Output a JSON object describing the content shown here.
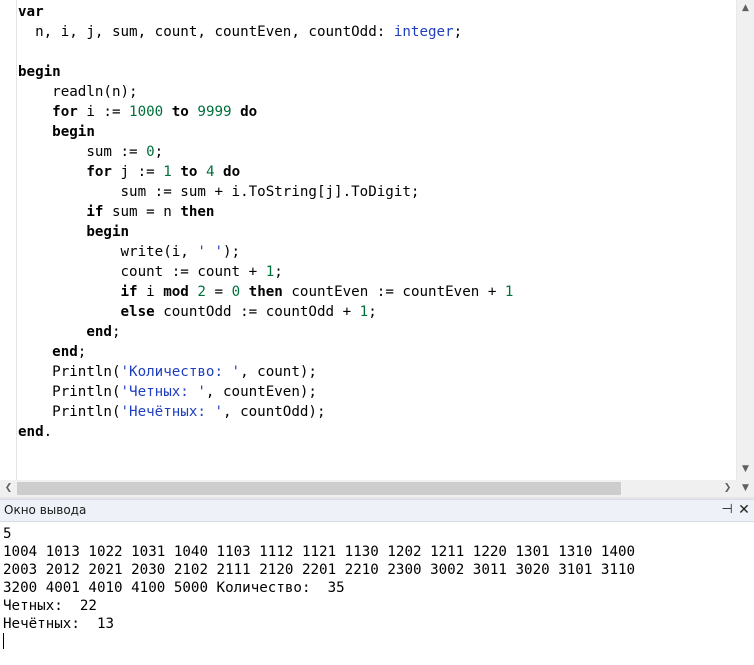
{
  "editor": {
    "lines": [
      [
        {
          "t": "var",
          "c": "kw"
        }
      ],
      [
        {
          "t": "  n, i, j, sum, count, countEven, countOdd: "
        },
        {
          "t": "integer",
          "c": "type"
        },
        {
          "t": ";"
        }
      ],
      [
        {
          "t": ""
        }
      ],
      [
        {
          "t": "begin",
          "c": "kw"
        }
      ],
      [
        {
          "t": "    readln(n);"
        }
      ],
      [
        {
          "t": "    "
        },
        {
          "t": "for",
          "c": "kw"
        },
        {
          "t": " i := "
        },
        {
          "t": "1000",
          "c": "num"
        },
        {
          "t": " "
        },
        {
          "t": "to",
          "c": "kw"
        },
        {
          "t": " "
        },
        {
          "t": "9999",
          "c": "num"
        },
        {
          "t": " "
        },
        {
          "t": "do",
          "c": "kw"
        }
      ],
      [
        {
          "t": "    "
        },
        {
          "t": "begin",
          "c": "kw"
        }
      ],
      [
        {
          "t": "        sum := "
        },
        {
          "t": "0",
          "c": "num"
        },
        {
          "t": ";"
        }
      ],
      [
        {
          "t": "        "
        },
        {
          "t": "for",
          "c": "kw"
        },
        {
          "t": " j := "
        },
        {
          "t": "1",
          "c": "num"
        },
        {
          "t": " "
        },
        {
          "t": "to",
          "c": "kw"
        },
        {
          "t": " "
        },
        {
          "t": "4",
          "c": "num"
        },
        {
          "t": " "
        },
        {
          "t": "do",
          "c": "kw"
        }
      ],
      [
        {
          "t": "            sum := sum + i.ToString[j].ToDigit;"
        }
      ],
      [
        {
          "t": "        "
        },
        {
          "t": "if",
          "c": "kw"
        },
        {
          "t": " sum = n "
        },
        {
          "t": "then",
          "c": "kw"
        }
      ],
      [
        {
          "t": "        "
        },
        {
          "t": "begin",
          "c": "kw"
        }
      ],
      [
        {
          "t": "            write(i, "
        },
        {
          "t": "' '",
          "c": "str"
        },
        {
          "t": ");"
        }
      ],
      [
        {
          "t": "            count := count + "
        },
        {
          "t": "1",
          "c": "num"
        },
        {
          "t": ";"
        }
      ],
      [
        {
          "t": "            "
        },
        {
          "t": "if",
          "c": "kw"
        },
        {
          "t": " i "
        },
        {
          "t": "mod",
          "c": "kw"
        },
        {
          "t": " "
        },
        {
          "t": "2",
          "c": "num"
        },
        {
          "t": " = "
        },
        {
          "t": "0",
          "c": "num"
        },
        {
          "t": " "
        },
        {
          "t": "then",
          "c": "kw"
        },
        {
          "t": " countEven := countEven + "
        },
        {
          "t": "1",
          "c": "num"
        }
      ],
      [
        {
          "t": "            "
        },
        {
          "t": "else",
          "c": "kw"
        },
        {
          "t": " countOdd := countOdd + "
        },
        {
          "t": "1",
          "c": "num"
        },
        {
          "t": ";"
        }
      ],
      [
        {
          "t": "        "
        },
        {
          "t": "end",
          "c": "kw"
        },
        {
          "t": ";"
        }
      ],
      [
        {
          "t": "    "
        },
        {
          "t": "end",
          "c": "kw"
        },
        {
          "t": ";"
        }
      ],
      [
        {
          "t": "    Println("
        },
        {
          "t": "'Количество: '",
          "c": "str"
        },
        {
          "t": ", count);"
        }
      ],
      [
        {
          "t": "    Println("
        },
        {
          "t": "'Четных: '",
          "c": "str"
        },
        {
          "t": ", countEven);"
        }
      ],
      [
        {
          "t": "    Println("
        },
        {
          "t": "'Нечётных: '",
          "c": "str"
        },
        {
          "t": ", countOdd);"
        }
      ],
      [
        {
          "t": "end",
          "c": "kw"
        },
        {
          "t": "."
        }
      ]
    ]
  },
  "scrollbars": {
    "up_icon": "triangle-up-icon",
    "down_icon": "triangle-down-icon",
    "left_icon": "chevron-left-icon",
    "right_icon": "chevron-right-icon"
  },
  "output_panel": {
    "title": "Окно вывода",
    "pin_glyph": "📌",
    "close_glyph": "✕",
    "lines": [
      "5",
      "1004 1013 1022 1031 1040 1103 1112 1121 1130 1202 1211 1220 1301 1310 1400",
      "2003 2012 2021 2030 2102 2111 2120 2201 2210 2300 3002 3011 3020 3101 3110",
      "3200 4001 4010 4100 5000 Количество:  35",
      "Четных:  22",
      "Нечётных:  13"
    ]
  },
  "colors": {
    "keyword": "#000000",
    "number": "#00703b",
    "type": "#1f3fbf",
    "string": "#1f3fbf",
    "panel_header_bg": "#eef2f8"
  }
}
